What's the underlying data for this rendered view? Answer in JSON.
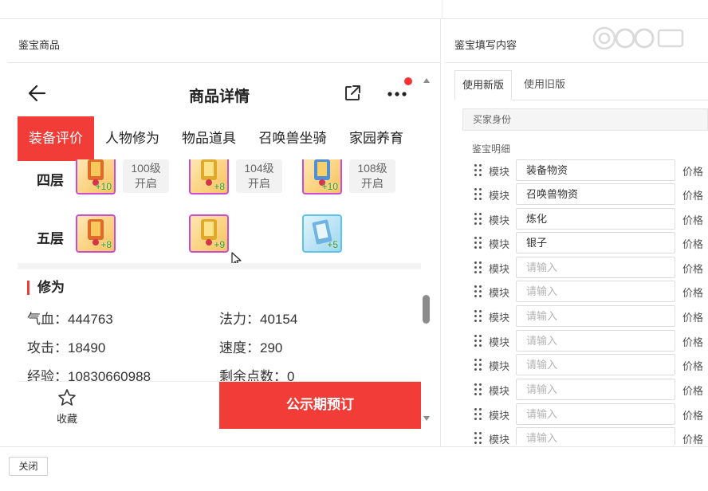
{
  "left_panel": {
    "title": "鉴宝商品"
  },
  "right_panel": {
    "title": "鉴宝填写内容"
  },
  "watermark": {
    "icon": "cc-live-logo-icon"
  },
  "phone": {
    "nav": {
      "title": "商品详情",
      "back_icon": "arrow-left-icon",
      "share_icon": "share-icon",
      "more_icon": "more-dots-icon"
    },
    "tabs": [
      {
        "label": "装备评价",
        "active": true
      },
      {
        "label": "人物修为",
        "active": false
      },
      {
        "label": "物品道具",
        "active": false
      },
      {
        "label": "召唤兽坐骑",
        "active": false
      },
      {
        "label": "家园养育",
        "active": false
      }
    ],
    "layers": [
      {
        "label": "四层",
        "items": [
          {
            "plus": "+10",
            "rarity": "purple"
          },
          {
            "plus": "+8",
            "rarity": "purple"
          },
          {
            "plus": "+10",
            "rarity": "purple"
          }
        ],
        "badges": [
          {
            "line1": "100级",
            "line2": "开启"
          },
          {
            "line1": "104级",
            "line2": "开启"
          },
          {
            "line1": "108级",
            "line2": "开启"
          }
        ]
      },
      {
        "label": "五层",
        "items": [
          {
            "plus": "+8",
            "rarity": "purple"
          },
          {
            "plus": "+9",
            "rarity": "purple"
          },
          {
            "plus": "+5",
            "rarity": "blue"
          }
        ]
      }
    ],
    "cultivation": {
      "title": "修为",
      "stats": [
        {
          "label": "气血：",
          "value": "444763"
        },
        {
          "label": "法力：",
          "value": "40154"
        },
        {
          "label": "攻击：",
          "value": "18490"
        },
        {
          "label": "速度：",
          "value": "290"
        },
        {
          "label": "经验：",
          "value": "10830660988"
        },
        {
          "label": "剩余点数：",
          "value": "0"
        }
      ]
    },
    "bottom": {
      "favorite_label": "收藏",
      "favorite_icon": "star-outline-icon",
      "cta_label": "公示期预订"
    }
  },
  "right": {
    "tabs": [
      {
        "label": "使用新版",
        "active": true
      },
      {
        "label": "使用旧版",
        "active": false
      }
    ],
    "buyer_identity_label": "买家身份",
    "detail_label": "鉴宝明细",
    "module_label": "模块",
    "price_label": "价格",
    "rows": [
      {
        "value": "装备物资",
        "placeholder": ""
      },
      {
        "value": "召唤兽物资",
        "placeholder": ""
      },
      {
        "value": "炼化",
        "placeholder": ""
      },
      {
        "value": "银子",
        "placeholder": ""
      },
      {
        "value": "",
        "placeholder": "请输入"
      },
      {
        "value": "",
        "placeholder": "请输入"
      },
      {
        "value": "",
        "placeholder": "请输入"
      },
      {
        "value": "",
        "placeholder": "请输入"
      },
      {
        "value": "",
        "placeholder": "请输入"
      },
      {
        "value": "",
        "placeholder": "请输入"
      },
      {
        "value": "",
        "placeholder": "请输入"
      },
      {
        "value": "",
        "placeholder": "请输入"
      }
    ]
  },
  "footer": {
    "close_label": "关闭"
  },
  "colors": {
    "accent_red": "#f13c38",
    "purple_frame": "#c94cd6",
    "blue_frame": "#5cc4e6"
  }
}
